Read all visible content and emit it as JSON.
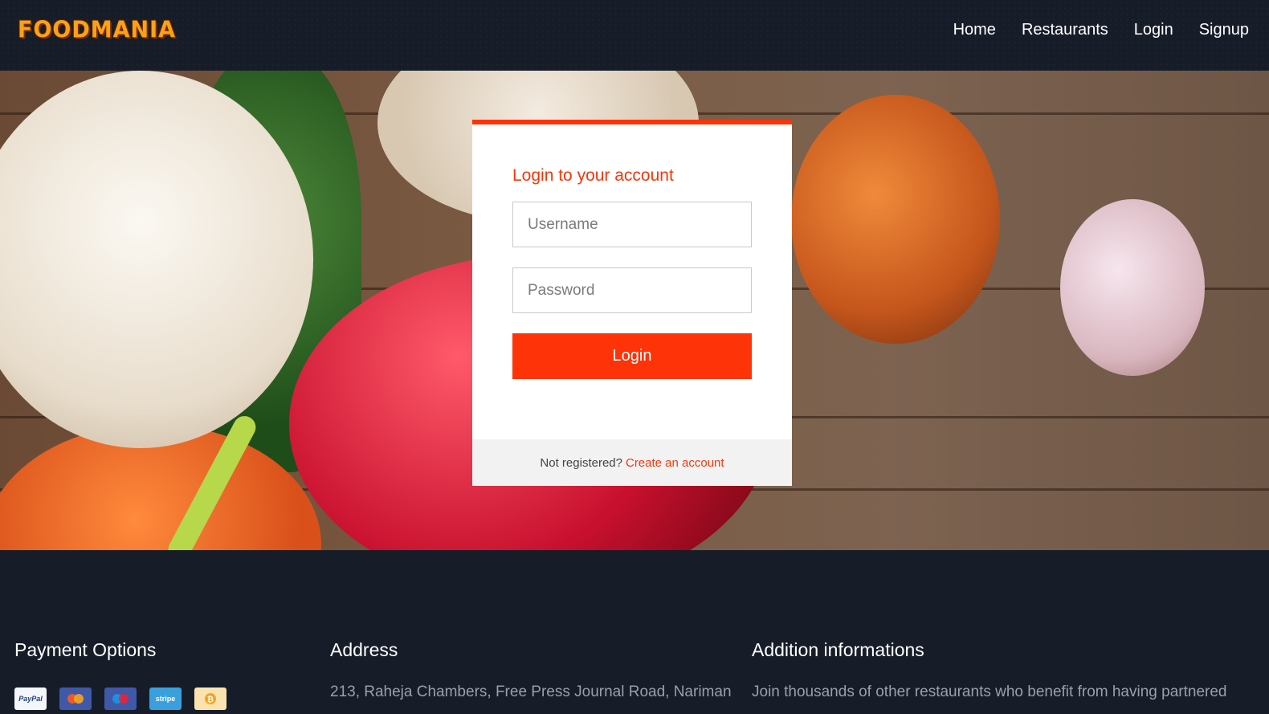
{
  "header": {
    "logo_text": "FOODMANIA",
    "nav": [
      "Home",
      "Restaurants",
      "Login",
      "Signup"
    ]
  },
  "login": {
    "title": "Login to your account",
    "username_placeholder": "Username",
    "password_placeholder": "Password",
    "button_label": "Login",
    "footer_text": "Not registered?",
    "footer_link": "Create an account"
  },
  "footer": {
    "payment_title": "Payment Options",
    "payment_methods": [
      "PayPal",
      "Mastercard",
      "Maestro",
      "stripe",
      "Bitcoin"
    ],
    "address_title": "Address",
    "address_text": "213, Raheja Chambers, Free Press Journal Road, Nariman",
    "info_title": "Addition informations",
    "info_text": "Join thousands of other restaurants who benefit from having partnered"
  },
  "colors": {
    "accent": "#ff3308",
    "header_bg": "#161d29"
  }
}
